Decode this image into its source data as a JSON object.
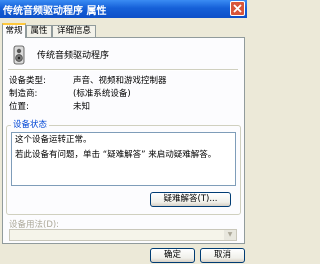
{
  "window": {
    "title": "传统音频驱动程序 属性"
  },
  "tabs": [
    {
      "label": "常规",
      "active": true
    },
    {
      "label": "属性",
      "active": false
    },
    {
      "label": "详细信息",
      "active": false
    }
  ],
  "device": {
    "icon": "speaker-icon",
    "name": "传统音频驱动程序",
    "properties": [
      {
        "label": "设备类型:",
        "value": "声音、视频和游戏控制器"
      },
      {
        "label": "制造商:",
        "value": "(标准系统设备)"
      },
      {
        "label": "位置:",
        "value": "未知"
      }
    ]
  },
  "status": {
    "group_title": "设备状态",
    "line1": "这个设备运转正常。",
    "line2": "若此设备有问题，单击 “疑难解答” 来启动疑难解答。",
    "troubleshoot_label": "疑难解答(T)..."
  },
  "usage": {
    "label": "设备用法(D):"
  },
  "footer": {
    "ok_label": "确定",
    "cancel_label": "取消"
  },
  "colors": {
    "titlebar": "#0d4fc8",
    "accent": "#0046d5",
    "tab_highlight": "#ffc83c"
  }
}
